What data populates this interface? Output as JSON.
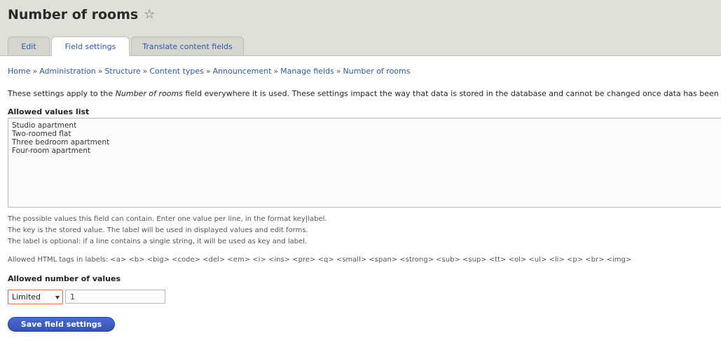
{
  "page": {
    "title": "Number of rooms"
  },
  "tabs": [
    {
      "label": "Edit"
    },
    {
      "label": "Field settings"
    },
    {
      "label": "Translate content fields"
    }
  ],
  "breadcrumb": {
    "separator": "»",
    "items": [
      "Home",
      "Administration",
      "Structure",
      "Content types",
      "Announcement",
      "Manage fields",
      "Number of rooms"
    ]
  },
  "intro": {
    "before": "These settings apply to the ",
    "field_name": "Number of rooms",
    "after": " field everywhere it is used. These settings impact the way that data is stored in the database and cannot be changed once data has been created."
  },
  "allowed_values": {
    "label": "Allowed values list",
    "value": "Studio apartment\nTwo-roomed flat\nThree bedroom apartment\nFour-room apartment",
    "help_lines": [
      "The possible values this field can contain. Enter one value per line, in the format key|label.",
      "The key is the stored value. The label will be used in displayed values and edit forms.",
      "The label is optional: if a line contains a single string, it will be used as key and label."
    ],
    "html_tags_help": "Allowed HTML tags in labels: <a> <b> <big> <code> <del> <em> <i> <ins> <pre> <q> <small> <span> <strong> <sub> <sup> <tt> <ol> <ul> <li> <p> <br> <img>"
  },
  "cardinality": {
    "label": "Allowed number of values",
    "select_value": "Limited",
    "number_value": "1"
  },
  "actions": {
    "save_label": "Save field settings"
  },
  "colors": {
    "header_bg": "#e0e0d8",
    "link": "#2d57a7",
    "button": "#3453b7",
    "select_focus_border": "#e26a34"
  },
  "icons": {
    "favorite": "star-outline-icon",
    "select": "chevron-down-icon"
  }
}
